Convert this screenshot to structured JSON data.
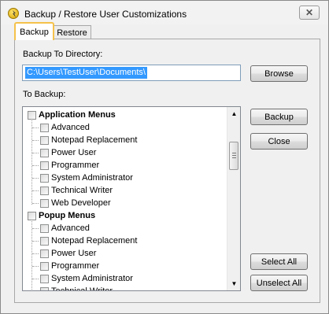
{
  "window": {
    "title": "Backup / Restore User Customizations",
    "close_glyph": "✕"
  },
  "tabs": [
    {
      "label": "Backup"
    },
    {
      "label": "Restore"
    }
  ],
  "backup_dir": {
    "label": "Backup To Directory:",
    "value": "C:\\Users\\TestUser\\Documents\\"
  },
  "buttons": {
    "browse": "Browse",
    "backup": "Backup",
    "close": "Close",
    "select_all": "Select All",
    "unselect_all": "Unselect All"
  },
  "to_backup": {
    "label": "To Backup:"
  },
  "tree": {
    "groups": [
      {
        "label": "Application Menus",
        "items": [
          "Advanced",
          "Notepad Replacement",
          "Power User",
          "Programmer",
          "System Administrator",
          "Technical Writer",
          "Web Developer"
        ]
      },
      {
        "label": "Popup Menus",
        "items": [
          "Advanced",
          "Notepad Replacement",
          "Power User",
          "Programmer",
          "System Administrator",
          "Technical Writer"
        ]
      }
    ]
  },
  "scrollbar": {
    "up_glyph": "▲",
    "down_glyph": "▼"
  }
}
